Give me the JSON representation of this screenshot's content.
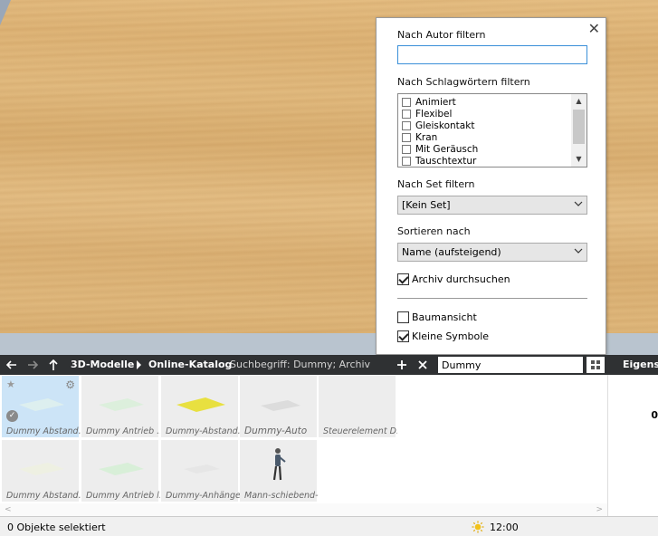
{
  "filter_panel": {
    "close_symbol": "✕",
    "author_label": "Nach Autor filtern",
    "author_value": "",
    "tags_label": "Nach Schlagwörtern filtern",
    "tags": [
      "Animiert",
      "Flexibel",
      "Gleiskontakt",
      "Kran",
      "Mit Geräusch",
      "Tauschtextur"
    ],
    "set_label": "Nach Set filtern",
    "set_value": "[Kein Set]",
    "sort_label": "Sortieren nach",
    "sort_value": "Name (aufsteigend)",
    "archive_label": "Archiv durchsuchen",
    "archive_checked": true,
    "treeview_label": "Baumansicht",
    "treeview_checked": false,
    "small_icons_label": "Kleine Symbole",
    "small_icons_checked": true
  },
  "toolbar": {
    "breadcrumb": [
      "3D-Modelle",
      "Online-Katalog"
    ],
    "search_term": "Suchbegriff: Dummy; Archiv",
    "search_value": "Dummy",
    "properties_title": "Eigensc"
  },
  "catalog": {
    "items": [
      {
        "label": "Dummy Abstand...",
        "selected": true
      },
      {
        "label": "Dummy Antrieb ..."
      },
      {
        "label": "Dummy-Abstand..."
      },
      {
        "label": "Dummy-Auto"
      },
      {
        "label": "Steuerelement D..."
      },
      {
        "label": "Dummy Abstand..."
      },
      {
        "label": "Dummy Antrieb l..."
      },
      {
        "label": "Dummy-Anhänger"
      },
      {
        "label": "Mann-schiebend-..."
      }
    ]
  },
  "properties": {
    "value": "0"
  },
  "status": {
    "selection": "0 Objekte selektiert",
    "time": "12:00"
  },
  "colors": {
    "accent": "#3a8fd8",
    "toolbar_bg": "#2f3133",
    "selected_tile": "#cce4f7"
  }
}
